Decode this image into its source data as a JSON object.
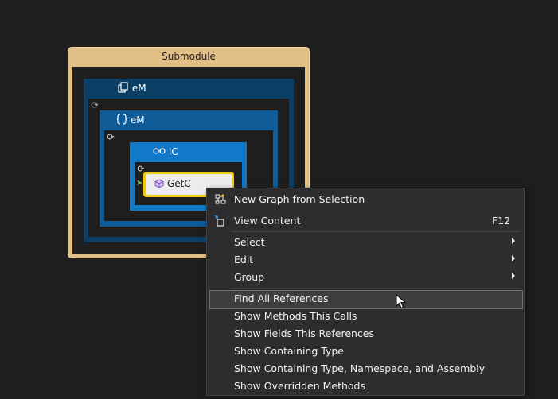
{
  "graph": {
    "submodule_title": "Submodule",
    "group1_title": "eM",
    "group2_title": "eM",
    "group3_title": "IC",
    "node_label": "GetC",
    "refresh_glyph": "⟳"
  },
  "menu": {
    "items": [
      {
        "label": "New Graph from Selection",
        "icon": "new-graph-icon"
      },
      {
        "label": "View Content",
        "shortcut": "F12",
        "icon": "view-content-icon"
      },
      {
        "label": "Select",
        "submenu": true
      },
      {
        "label": "Edit",
        "submenu": true
      },
      {
        "label": "Group",
        "submenu": true
      },
      {
        "label": "Find All References",
        "highlighted": true
      },
      {
        "label": "Show Methods This Calls"
      },
      {
        "label": "Show Fields This References"
      },
      {
        "label": "Show Containing Type"
      },
      {
        "label": "Show Containing Type, Namespace, and Assembly"
      },
      {
        "label": "Show Overridden Methods"
      }
    ]
  },
  "colors": {
    "background": "#1e1e1e",
    "submodule": "#e2bf86",
    "group_dark": "#0c3f66",
    "group_mid": "#0e5b98",
    "group_light": "#1179c8",
    "node_border": "#f2c811",
    "menu_bg": "#2d2d30"
  }
}
